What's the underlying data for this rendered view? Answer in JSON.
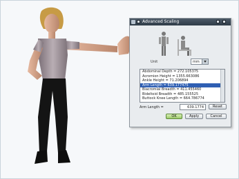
{
  "dialog": {
    "title": "Advanced Scaling",
    "unit_label": "Unit",
    "unit_value": "mm",
    "measurements": [
      "Abdominal Depth = 272.105375",
      "Acromion Height = 1355.663086",
      "Ankle Height = 71.206894",
      "Arm Length = 639.177475",
      "Biacromial Breadth = 411.455460",
      "Bideltoid Breadth = 485.155525",
      "Buttock Knee Length = 664.786774"
    ],
    "selected_index": 3,
    "value_label": "Arm Length =",
    "value": "639.1774",
    "reset_label": "Reset",
    "ok_label": "OK",
    "apply_label": "Apply",
    "cancel_label": "Cancel"
  },
  "colors": {
    "title_bar": "#2f3b47",
    "selection": "#2f5fb3",
    "ok_button": "#9cc96a"
  }
}
